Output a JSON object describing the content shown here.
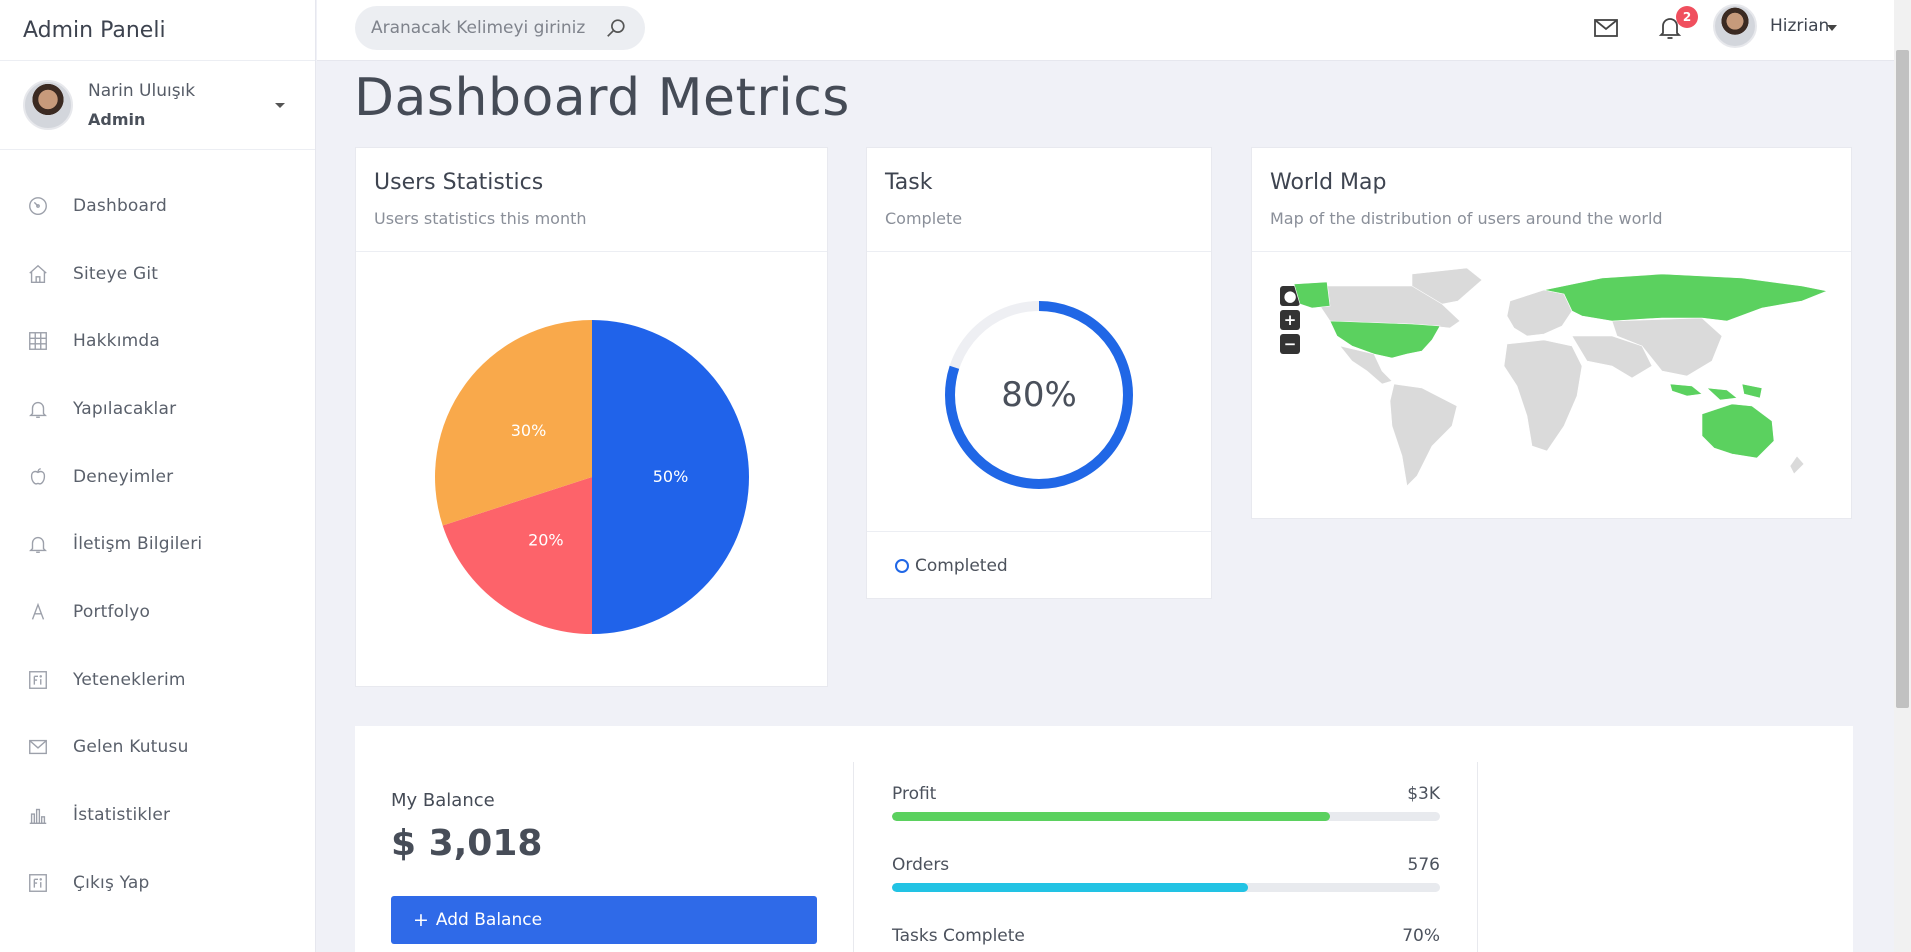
{
  "sidebar": {
    "brand": "Admin Paneli",
    "user": {
      "name": "Narin Uluışık",
      "role": "Admin"
    },
    "items": [
      {
        "label": "Dashboard",
        "icon": "gauge-icon"
      },
      {
        "label": "Siteye Git",
        "icon": "home-icon"
      },
      {
        "label": "Hakkımda",
        "icon": "grid-icon"
      },
      {
        "label": "Yapılacaklar",
        "icon": "bell-icon"
      },
      {
        "label": "Deneyimler",
        "icon": "apple-icon"
      },
      {
        "label": "İletişm Bilgileri",
        "icon": "bell-icon"
      },
      {
        "label": "Portfolyo",
        "icon": "letter-a-icon"
      },
      {
        "label": "Yeteneklerim",
        "icon": "fi-icon"
      },
      {
        "label": "Gelen Kutusu",
        "icon": "mail-icon"
      },
      {
        "label": "İstatistikler",
        "icon": "bar-chart-icon"
      },
      {
        "label": "Çıkış Yap",
        "icon": "fi-icon"
      }
    ]
  },
  "topbar": {
    "search_placeholder": "Aranacak Kelimeyi giriniz",
    "notification_count": "2",
    "username": "Hizrian"
  },
  "main": {
    "title": "Dashboard Metrics",
    "users_card": {
      "title": "Users Statistics",
      "subtitle": "Users statistics this month"
    },
    "task_card": {
      "title": "Task",
      "subtitle": "Complete",
      "percent": "80%",
      "progress": 0.8,
      "footer": "Completed",
      "color": "#2067e6"
    },
    "map_card": {
      "title": "World Map",
      "subtitle": "Map of the distribution of users around the world",
      "highlight_color": "#5bd15f",
      "controls": [
        "●",
        "+",
        "−"
      ]
    },
    "balance": {
      "label": "My Balance",
      "value": "$ 3,018",
      "button": "Add Balance",
      "stats": [
        {
          "label": "Profit",
          "value": "$3K",
          "fill": 0.8,
          "color": "#5bd15f"
        },
        {
          "label": "Orders",
          "value": "576",
          "fill": 0.65,
          "color": "#22c3e4"
        },
        {
          "label": "Tasks Complete",
          "value": "70%",
          "fill": 0.7,
          "color": "#2f6ae8"
        }
      ]
    }
  },
  "chart_data": {
    "type": "pie",
    "title": "",
    "slices": [
      {
        "label": "50%",
        "value": 50,
        "color": "#2063ea"
      },
      {
        "label": "20%",
        "value": 20,
        "color": "#fd636a"
      },
      {
        "label": "30%",
        "value": 30,
        "color": "#f9a94b"
      }
    ]
  }
}
